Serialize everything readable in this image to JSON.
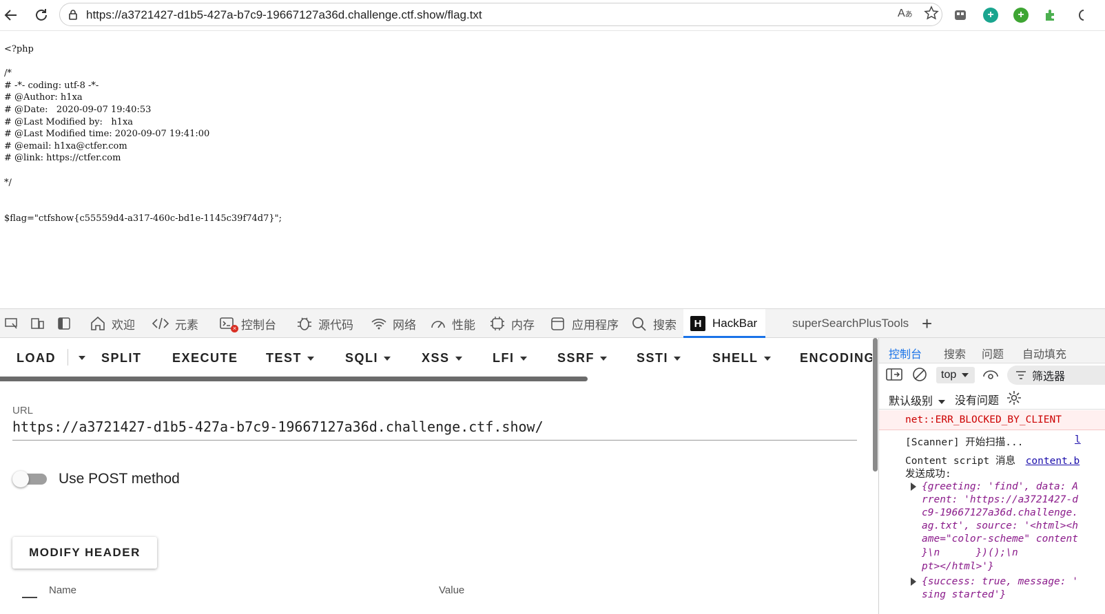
{
  "browser": {
    "url": "https://a3721427-d1b5-427a-b7c9-19667127a36d.challenge.ctf.show/flag.txt"
  },
  "page": {
    "lines": [
      "<?php",
      "",
      "/*",
      "# -*- coding: utf-8 -*-",
      "# @Author: h1xa",
      "# @Date:   2020-09-07 19:40:53",
      "# @Last Modified by:   h1xa",
      "# @Last Modified time: 2020-09-07 19:41:00",
      "# @email: h1xa@ctfer.com",
      "# @link: https://ctfer.com",
      "",
      "*/",
      "",
      "",
      "$flag=\"ctfshow{c55559d4-a317-460c-bd1e-1145c39f74d7}\";"
    ]
  },
  "devtools": {
    "tabs": [
      {
        "label": "欢迎"
      },
      {
        "label": "元素"
      },
      {
        "label": "控制台"
      },
      {
        "label": "源代码"
      },
      {
        "label": "网络"
      },
      {
        "label": "性能"
      },
      {
        "label": "内存"
      },
      {
        "label": "应用程序"
      },
      {
        "label": "搜索"
      },
      {
        "label": "HackBar"
      },
      {
        "label": "superSearchPlusTools"
      }
    ],
    "add_tab": "+"
  },
  "hackbar": {
    "menu": [
      "LOAD",
      "SPLIT",
      "EXECUTE",
      "TEST",
      "SQLI",
      "XSS",
      "LFI",
      "SSRF",
      "SSTI",
      "SHELL",
      "ENCODING"
    ],
    "url_label": "URL",
    "url_value": "https://a3721427-d1b5-427a-b7c9-19667127a36d.challenge.ctf.show/",
    "post_label": "Use POST method",
    "post_enabled": false,
    "modify_header": "MODIFY HEADER",
    "col_name": "Name",
    "col_value": "Value"
  },
  "console": {
    "tabs": [
      "控制台",
      "搜索",
      "问题",
      "自动填充"
    ],
    "context": "top",
    "filter": "筛选器",
    "level": "默认级别",
    "issues": "没有问题",
    "lines": [
      "net::ERR_BLOCKED_BY_CLIENT",
      "[Scanner] 开始扫描...",
      "Content script 消息",
      "content.b",
      "发送成功:",
      "{greeting: 'find', data: A",
      "rrent: 'https://a3721427-d",
      "c9-19667127a36d.challenge.",
      "ag.txt', source: '<html><h",
      "ame=\"color-scheme\" content",
      "}\\n      })();\\n",
      "pt></html>'}",
      "{success: true, message: '",
      "sing started'}"
    ]
  }
}
